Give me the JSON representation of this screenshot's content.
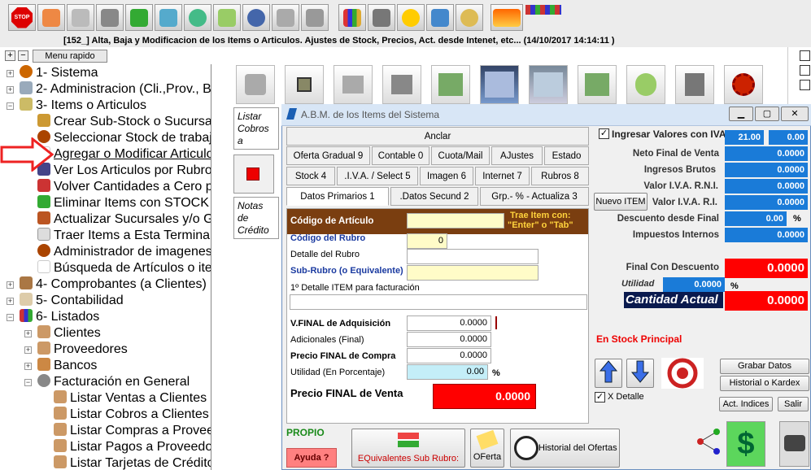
{
  "window_title": "[152_] Alta, Baja y Modificacion de los Items o Articulos. Ajustes de Stock, Precios, Act. desde Intenet, etc... (14/10/2017 14:14:11  )",
  "toolbar": {
    "stop_label": "STOP"
  },
  "menu": {
    "plus": "+",
    "minus": "−",
    "menu_rapido": "Menu rapido"
  },
  "tree": [
    {
      "label": "1- Sistema"
    },
    {
      "label": "2- Administracion (Cli.,Prov., B"
    },
    {
      "label": "3- Items o Articulos"
    },
    {
      "label": "Crear Sub-Stock o Sucursa"
    },
    {
      "label": "Seleccionar Stock de trabaj"
    },
    {
      "label": "Agregar o Modificar Articulo"
    },
    {
      "label": "Ver Los Articulos por Rubro"
    },
    {
      "label": "Volver Cantidades a Cero p"
    },
    {
      "label": "Eliminar Items con STOCK"
    },
    {
      "label": "Actualizar Sucursales y/o  G"
    },
    {
      "label": "Traer Items a Esta Terminal"
    },
    {
      "label": "Administrador de imagenes"
    },
    {
      "label": "Búsqueda de Artículos o ite"
    },
    {
      "label": "4- Comprobantes (a Clientes)"
    },
    {
      "label": "5- Contabilidad"
    },
    {
      "label": "6- Listados"
    },
    {
      "label": "Clientes"
    },
    {
      "label": "Proveedores"
    },
    {
      "label": "Bancos"
    },
    {
      "label": "Facturación en General"
    },
    {
      "label": "Listar Ventas a Clientes"
    },
    {
      "label": "Listar Cobros a Clientes"
    },
    {
      "label": "Listar Compras a Proveedores"
    },
    {
      "label": "Listar Pagos a Proveedores"
    },
    {
      "label": "Listar Tarjetas de Crédito"
    }
  ],
  "side_panel": {
    "listar": "Listar Cobros a",
    "notas": "Notas de Crédito"
  },
  "dialog": {
    "title": "A.B.M. de los Items del Sistema",
    "anclar": "Anclar",
    "tabs_row1": [
      "Oferta Gradual 9",
      "Contable 0",
      "Cuota/Mail",
      "AJustes",
      "Estado"
    ],
    "tabs_row2": [
      "Stock 4",
      ".I.V.A. / Select 5",
      "Imagen 6",
      "Internet 7",
      "Rubros 8"
    ],
    "tabs_row3": [
      "Datos Primarios 1",
      ".Datos Secund 2",
      "Grp.- % - Actualiza 3"
    ],
    "form": {
      "codigo_articulo": "Código de Artículo",
      "trae_item": "Trae Item con:\n\"Enter\" o \"Tab\"",
      "codigo_rubro": "Código del Rubro",
      "codigo_rubro_value": "0",
      "detalle_rubro": "Detalle del Rubro",
      "sub_rubro": "Sub-Rubro (o Equivalente)",
      "detalle_item": "1º Detalle ITEM para facturación",
      "vfinal_adq": "V.FINAL de Adquisición",
      "vfinal_adq_value": "0.0000",
      "adicionales": "Adicionales (Final)",
      "adicionales_value": "0.0000",
      "precio_compra": "Precio FINAL de Compra",
      "precio_compra_value": "0.0000",
      "utilidad_pct": "Utilidad (En Porcentaje)",
      "utilidad_pct_value": "0.00",
      "pct_sign": "%",
      "precio_venta": "Precio FINAL de  Venta",
      "precio_venta_value": "0.0000"
    },
    "right": {
      "ingresar_iva": "Ingresar Valores con IVA",
      "iva_rate": "21.00",
      "iva_extra": "0.00",
      "neto_final": "Neto Final de Venta",
      "neto_final_value": "0.0000",
      "ingresos_brutos": "Ingresos Brutos",
      "ingresos_brutos_value": "0.0000",
      "valor_iva_rni": "Valor I.V.A. R.N.I.",
      "valor_iva_rni_value": "0.0000",
      "nuevo_item": "Nuevo ITEM",
      "valor_iva_ri": "Valor I.V.A. R.I.",
      "valor_iva_ri_value": "0.0000",
      "descuento": "Descuento desde Final",
      "descuento_value": "0.00",
      "descuento_pct": "%",
      "impuestos": "Impuestos Internos",
      "impuestos_value": "0.0000",
      "final_descuento": "Final Con Descuento",
      "final_descuento_value": "0.0000",
      "utilidad": "Utilidad",
      "utilidad_value": "0.0000",
      "utilidad_pct": "%",
      "cantidad_actual": "Cantidad Actual",
      "cantidad_actual_value": "0.0000",
      "en_stock": "En Stock Principal",
      "grabar": "Grabar Datos",
      "historial_kardex": "Historial o Kardex",
      "x_detalle": "X Detalle",
      "act_indices": "Act. Indices",
      "salir": "Salir"
    },
    "bottom": {
      "propio": "PROPIO",
      "ayuda": "Ayuda ?",
      "equivalentes": "EQuivalentes Sub Rubro:",
      "oferta": "OFerta",
      "historial_ofertas": "Historial del Ofertas"
    }
  },
  "colors": {
    "accent_blue": "#1a7bd8",
    "red": "#ff0000",
    "brown": "#7a3e10",
    "yellow": "#fffcc8"
  }
}
